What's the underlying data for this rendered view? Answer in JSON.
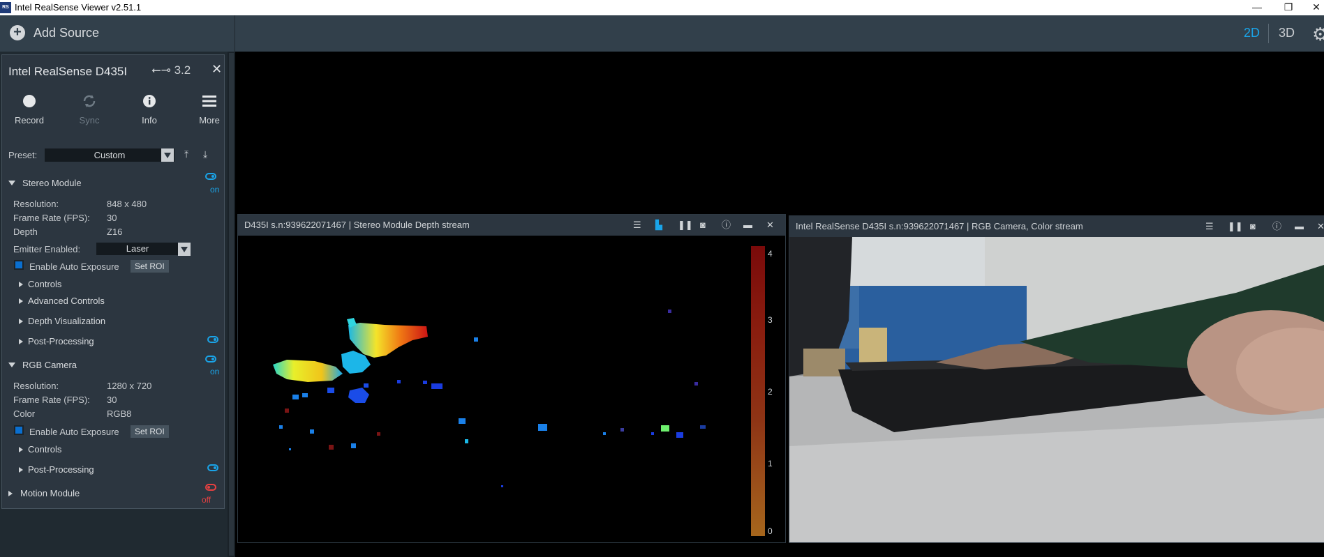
{
  "window": {
    "title": "Intel RealSense Viewer v2.51.1",
    "app_icon": "RS"
  },
  "toolbar": {
    "add_source": "Add Source",
    "mode_2d": "2D",
    "mode_3d": "3D"
  },
  "device": {
    "name": "Intel RealSense D435I",
    "usb": "3.2",
    "actions": [
      {
        "label": "Record",
        "enabled": true
      },
      {
        "label": "Sync",
        "enabled": false
      },
      {
        "label": "Info",
        "enabled": true
      },
      {
        "label": "More",
        "enabled": true
      }
    ],
    "preset": {
      "label": "Preset:",
      "value": "Custom"
    }
  },
  "stereo_module": {
    "title": "Stereo Module",
    "state": "on",
    "resolution_label": "Resolution:",
    "resolution": "848 x 480",
    "fps_label": "Frame Rate (FPS):",
    "fps": "30",
    "format_label": "Depth",
    "format": "Z16",
    "emitter_label": "Emitter Enabled:",
    "emitter_value": "Laser",
    "auto_exposure": "Enable Auto Exposure",
    "set_roi": "Set ROI",
    "sub_sections": [
      "Controls",
      "Advanced Controls",
      "Depth Visualization",
      "Post-Processing"
    ]
  },
  "rgb_camera": {
    "title": "RGB Camera",
    "state": "on",
    "resolution_label": "Resolution:",
    "resolution": "1280 x 720",
    "fps_label": "Frame Rate (FPS):",
    "fps": "30",
    "format_label": "Color",
    "format": "RGB8",
    "auto_exposure": "Enable Auto Exposure",
    "set_roi": "Set ROI",
    "sub_sections": [
      "Controls",
      "Post-Processing"
    ]
  },
  "motion_module": {
    "title": "Motion Module",
    "state": "off"
  },
  "depth_stream": {
    "title": "D435I s.n:939622071467 | Stereo Module Depth stream",
    "colorbar_ticks": [
      "4",
      "3",
      "2",
      "1",
      "0"
    ]
  },
  "color_stream": {
    "title": "Intel RealSense D435I s.n:939622071467 | RGB Camera, Color stream"
  },
  "colors": {
    "accent": "#1aa4e8",
    "off": "#e84040",
    "panel": "#2c3640"
  }
}
